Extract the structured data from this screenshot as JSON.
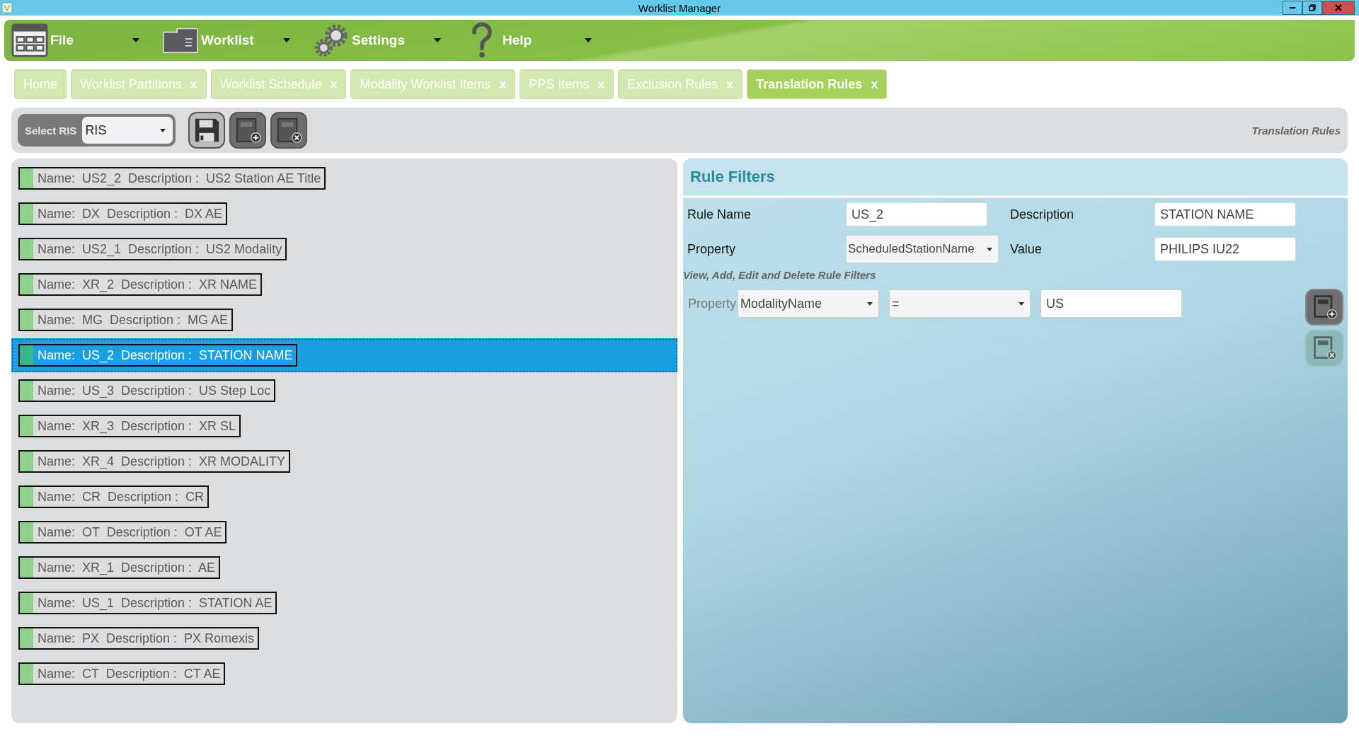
{
  "window": {
    "title": "Worklist Manager"
  },
  "menu": [
    {
      "label": "File",
      "kind": "grid"
    },
    {
      "label": "Worklist",
      "kind": "folder"
    },
    {
      "label": "Settings",
      "kind": "gears"
    },
    {
      "label": "Help",
      "kind": "help"
    }
  ],
  "tabs": [
    {
      "label": "Home",
      "selected": false
    },
    {
      "label": "Worklist Partitions",
      "close": "x",
      "selected": false
    },
    {
      "label": "Worklist Schedule",
      "close": "x",
      "selected": false
    },
    {
      "label": "Modality Worklist Items",
      "close": "x",
      "selected": false
    },
    {
      "label": "PPS Items",
      "close": "x",
      "selected": false
    },
    {
      "label": "Exclusion Rules",
      "close": "x",
      "selected": false
    },
    {
      "label": "Translation Rules",
      "close": "x",
      "selected": true
    }
  ],
  "toolbar": {
    "ris_label": "Select RIS",
    "ris_value": "RIS",
    "buttons": [
      {
        "kind": "save"
      },
      {
        "kind": "add"
      },
      {
        "kind": "delete"
      }
    ],
    "page_title": "Translation Rules"
  },
  "rules": [
    {
      "text": "Name:  US2_2  Description :  US2 Station AE Title",
      "selected": false
    },
    {
      "text": "Name:  DX  Description :  DX AE",
      "selected": false
    },
    {
      "text": "Name:  US2_1  Description :  US2 Modality",
      "selected": false
    },
    {
      "text": "Name:  XR_2  Description :  XR NAME",
      "selected": false
    },
    {
      "text": "Name:  MG  Description :  MG AE",
      "selected": false
    },
    {
      "text": "Name:  US_2  Description :  STATION NAME",
      "selected": true
    },
    {
      "text": "Name:  US_3  Description :  US Step Loc",
      "selected": false
    },
    {
      "text": "Name:  XR_3  Description :  XR SL",
      "selected": false
    },
    {
      "text": "Name:  XR_4  Description :  XR MODALITY",
      "selected": false
    },
    {
      "text": "Name:  CR  Description :  CR",
      "selected": false
    },
    {
      "text": "Name:  OT  Description :  OT AE",
      "selected": false
    },
    {
      "text": "Name:  XR_1  Description :  AE",
      "selected": false
    },
    {
      "text": "Name:  US_1  Description :  STATION AE",
      "selected": false
    },
    {
      "text": "Name:  PX  Description :  PX Romexis",
      "selected": false
    },
    {
      "text": "Name:  CT  Description :  CT AE",
      "selected": false
    }
  ],
  "rule_filters": {
    "title": "Rule Filters",
    "fields": [
      {
        "label": "Rule Name",
        "value": "US_2",
        "kind": "text"
      },
      {
        "label": "Description",
        "value": "STATION NAME",
        "kind": "text"
      },
      {
        "label": "Property",
        "value": "ScheduledStationName",
        "kind": "select"
      },
      {
        "label": "Value",
        "value": "PHILIPS IU22",
        "kind": "text"
      }
    ],
    "hint": "View, Add, Edit and Delete Rule Filters",
    "filter": {
      "label": "Property",
      "property": "ModalityName",
      "operator": "=",
      "value": "US"
    },
    "buttons": [
      {
        "kind": "add",
        "disabled": false
      },
      {
        "kind": "delete",
        "disabled": true
      }
    ]
  }
}
